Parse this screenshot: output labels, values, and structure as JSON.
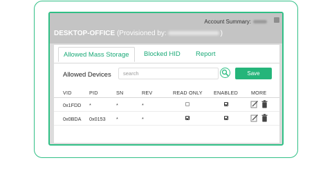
{
  "header": {
    "account_summary": "Account Summary:",
    "device_name": "DESKTOP-OFFICE",
    "provisioned_prefix": "(Provisioned by:",
    "provisioned_suffix": ")"
  },
  "tabs": [
    {
      "label": "Allowed Mass Storage",
      "active": true
    },
    {
      "label": "Blocked HID",
      "active": false
    },
    {
      "label": "Report",
      "active": false
    }
  ],
  "toolbar": {
    "title": "Allowed Devices",
    "search_placeholder": "search",
    "save_label": "Save"
  },
  "table": {
    "columns": [
      "VID",
      "PID",
      "SN",
      "REV",
      "READ ONLY",
      "ENABLED",
      "MORE"
    ],
    "rows": [
      {
        "vid": "0x1FDD",
        "pid": "*",
        "sn": "*",
        "rev": "*",
        "read_only": false,
        "enabled": true
      },
      {
        "vid": "0x0BDA",
        "pid": "0x0153",
        "sn": "*",
        "rev": "*",
        "read_only": true,
        "enabled": true
      }
    ]
  },
  "colors": {
    "accent": "#2fbf85",
    "save_button": "#25b57a",
    "header_bg": "#c4c4c4"
  },
  "icons": [
    "search-icon",
    "edit-icon",
    "delete-icon",
    "chevron-icon"
  ]
}
